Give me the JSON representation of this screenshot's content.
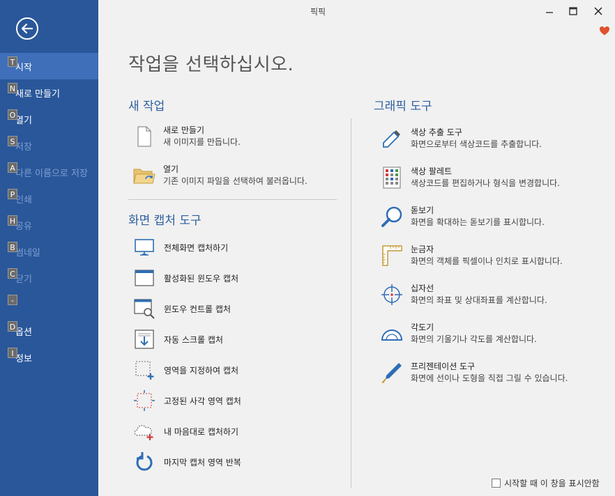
{
  "window": {
    "title": "픽픽",
    "min_icon": "minimize-icon",
    "max_icon": "maximize-icon",
    "close_icon": "close-icon"
  },
  "sidebar": {
    "items": [
      {
        "key": "T",
        "label": "시작"
      },
      {
        "key": "N",
        "label": "새로 만들기"
      },
      {
        "key": "O",
        "label": "열기"
      },
      {
        "key": "S",
        "label": "저장"
      },
      {
        "key": "A",
        "label": "다른 이름으로 저장"
      },
      {
        "key": "P",
        "label": "인쇄"
      },
      {
        "key": "H",
        "label": "공유"
      },
      {
        "key": "B",
        "label": "썸네일"
      },
      {
        "key": "C",
        "label": "닫기"
      },
      {
        "key": "-",
        "label": ""
      },
      {
        "key": "D",
        "label": "옵션"
      },
      {
        "key": "I",
        "label": "정보"
      }
    ]
  },
  "main": {
    "title": "작업을 선택하십시오.",
    "new_task": {
      "title": "새 작업",
      "items": [
        {
          "title": "새로 만들기",
          "desc": "새 이미지를 만듭니다."
        },
        {
          "title": "열기",
          "desc": "기존 이미지 파일을 선택하여 불러옵니다."
        }
      ]
    },
    "capture": {
      "title": "화면 캡처 도구",
      "items": [
        "전체화면 캡처하기",
        "활성화된 윈도우 캡처",
        "윈도우 컨트롤 캡처",
        "자동 스크롤 캡처",
        "영역을 지정하여 캡처",
        "고정된 사각 영역 캡처",
        "내 마음대로 캡처하기",
        "마지막 캡처 영역 반복"
      ]
    },
    "graphics": {
      "title": "그래픽 도구",
      "items": [
        {
          "title": "색상 추출 도구",
          "desc": "화면으로부터 색상코드를 추출합니다."
        },
        {
          "title": "색상 팔레트",
          "desc": "색상코드를 편집하거나 형식을 변경합니다."
        },
        {
          "title": "돋보기",
          "desc": "화면을 확대하는 돋보기를 표시합니다."
        },
        {
          "title": "눈금자",
          "desc": "화면의 객체를 픽셀이나 인치로 표시합니다."
        },
        {
          "title": "십자선",
          "desc": "화면의 좌표 및 상대좌표를 계산합니다."
        },
        {
          "title": "각도기",
          "desc": "화면의 기울기나 각도를 계산합니다."
        },
        {
          "title": "프리젠테이션 도구",
          "desc": "화면에 선이나 도형을 직접 그릴 수 있습니다."
        }
      ]
    },
    "footer": {
      "checkbox_label": "시작할 때 이 창을 표시안함",
      "checked": false
    }
  },
  "colors": {
    "sidebar": "#2a579a",
    "active": "#3f6fb8",
    "accent": "#2e5f9f",
    "heart": "#e0522e"
  }
}
